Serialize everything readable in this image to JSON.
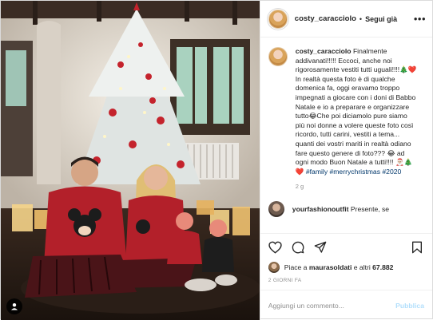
{
  "post": {
    "username": "costy_caracciolo",
    "separator": "•",
    "follow_label": "Segui già",
    "more_icon": "more-horizontal-icon",
    "caption": {
      "username": "costy_caracciolo",
      "text": "Finalmente addivanati!!!!! Eccoci, anche noi rigorosamente vestiti tutti uguali!!!!🎄❤️In realtà questa foto è di qualche domenica fa, oggi eravamo troppo impegnati a giocare con i doni di Babbo Natale e io a preparare e organizzare tutto😂Che poi diciamolo pure siamo più noi donne a volere queste foto così ricordo, tutti carini, vestiti a tema... quanti dei vostri mariti in realtà odiano fare questo genere di foto??? 😂 ad ogni modo Buon Natale a tutti!!!! 🎅🏼🎄❤️",
      "hashtags": "#family #merrychristmas #2020",
      "age": "2 g"
    },
    "reply": {
      "username": "yourfashionoutfit",
      "text": "Presente, se"
    },
    "actions": {
      "like_icon": "heart-icon",
      "comment_icon": "comment-icon",
      "share_icon": "paper-plane-icon",
      "save_icon": "bookmark-icon"
    },
    "likes": {
      "prefix": "Piace a",
      "liker": "maurasoldati",
      "middle": "e altri",
      "count": "67.882"
    },
    "date": "2 GIORNI FA",
    "comment_input": {
      "placeholder": "Aggiungi un commento...",
      "publish_label": "Pubblica"
    }
  },
  "photo": {
    "description_icon": "user-tag-icon"
  },
  "colors": {
    "text": "#262626",
    "secondary": "#8e8e8e",
    "hashtag": "#00376b",
    "publish_disabled": "#b2dffc",
    "pajama_red": "#b3202a"
  }
}
